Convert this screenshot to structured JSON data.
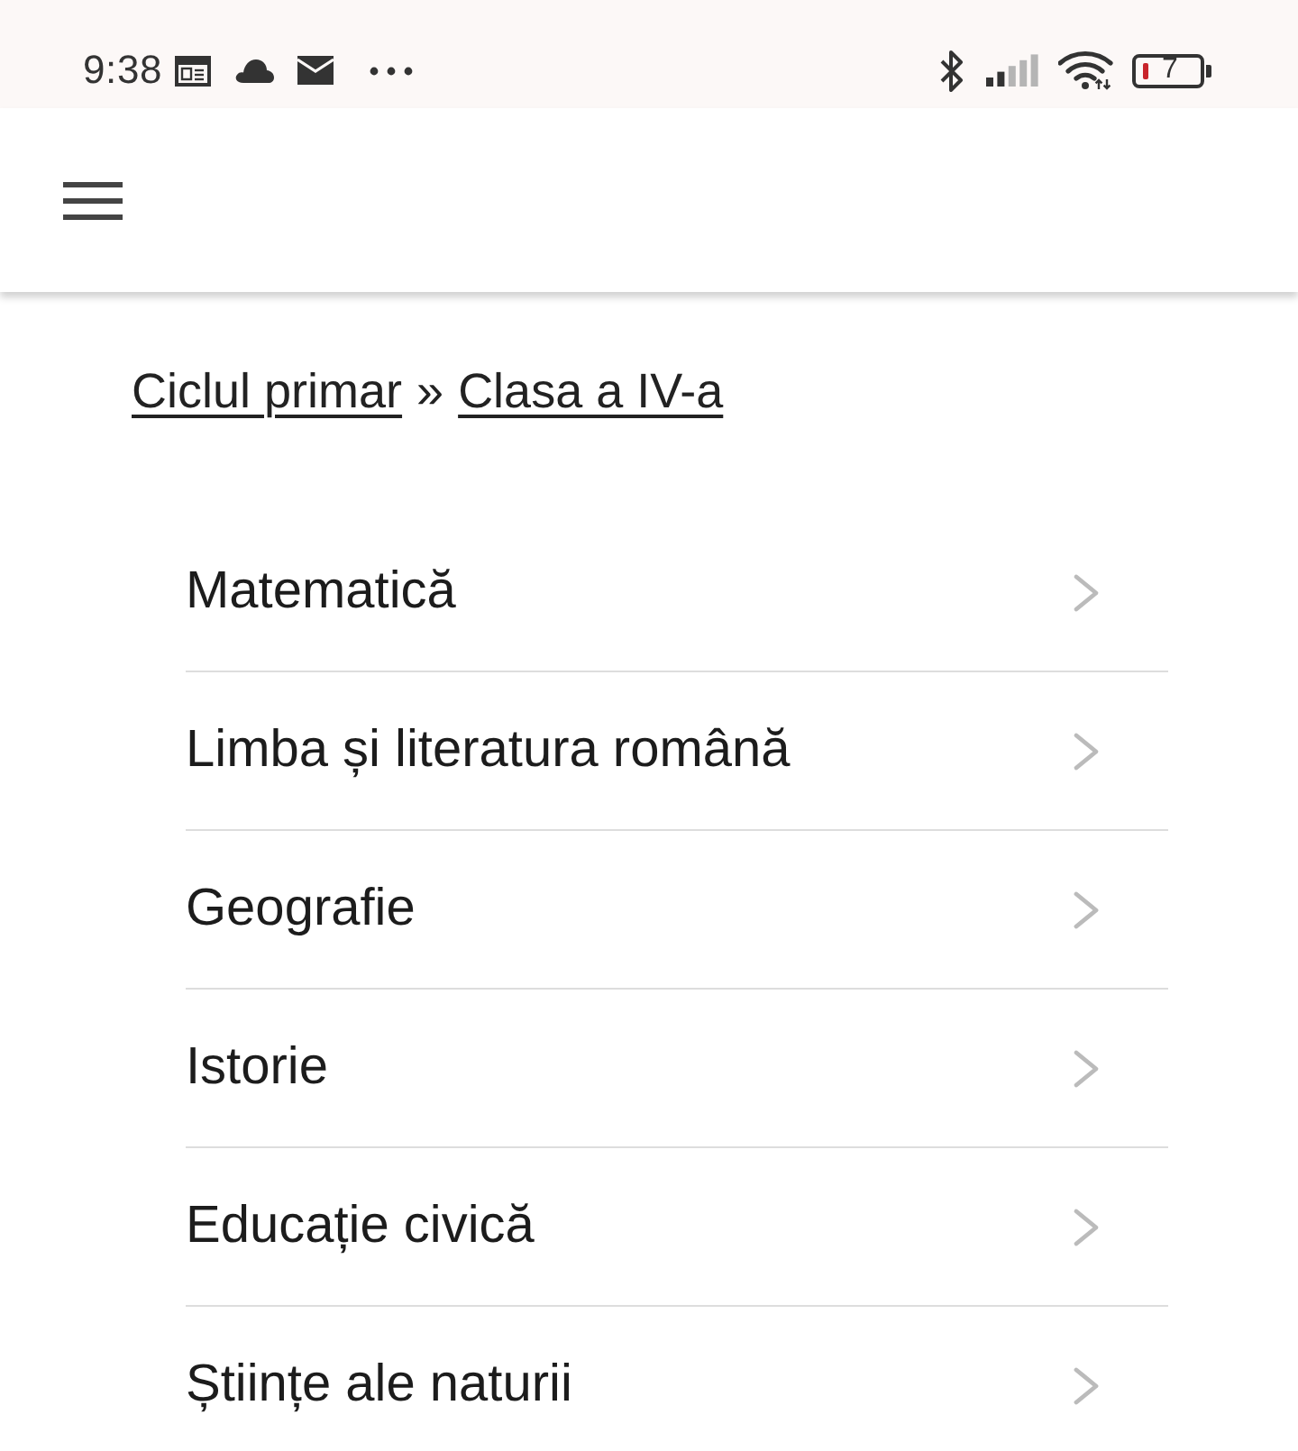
{
  "status_bar": {
    "time": "9:38",
    "battery": "7"
  },
  "breadcrumb": [
    {
      "kind": "link",
      "text": "Ciclul primar"
    },
    {
      "kind": "separator",
      "text": "»"
    },
    {
      "kind": "link",
      "text": "Clasa a IV-a"
    }
  ],
  "subjects": [
    {
      "label": "Matematică"
    },
    {
      "label": "Limba și literatura română"
    },
    {
      "label": "Geografie"
    },
    {
      "label": "Istorie"
    },
    {
      "label": "Educație civică"
    },
    {
      "label": "Științe ale naturii"
    }
  ]
}
